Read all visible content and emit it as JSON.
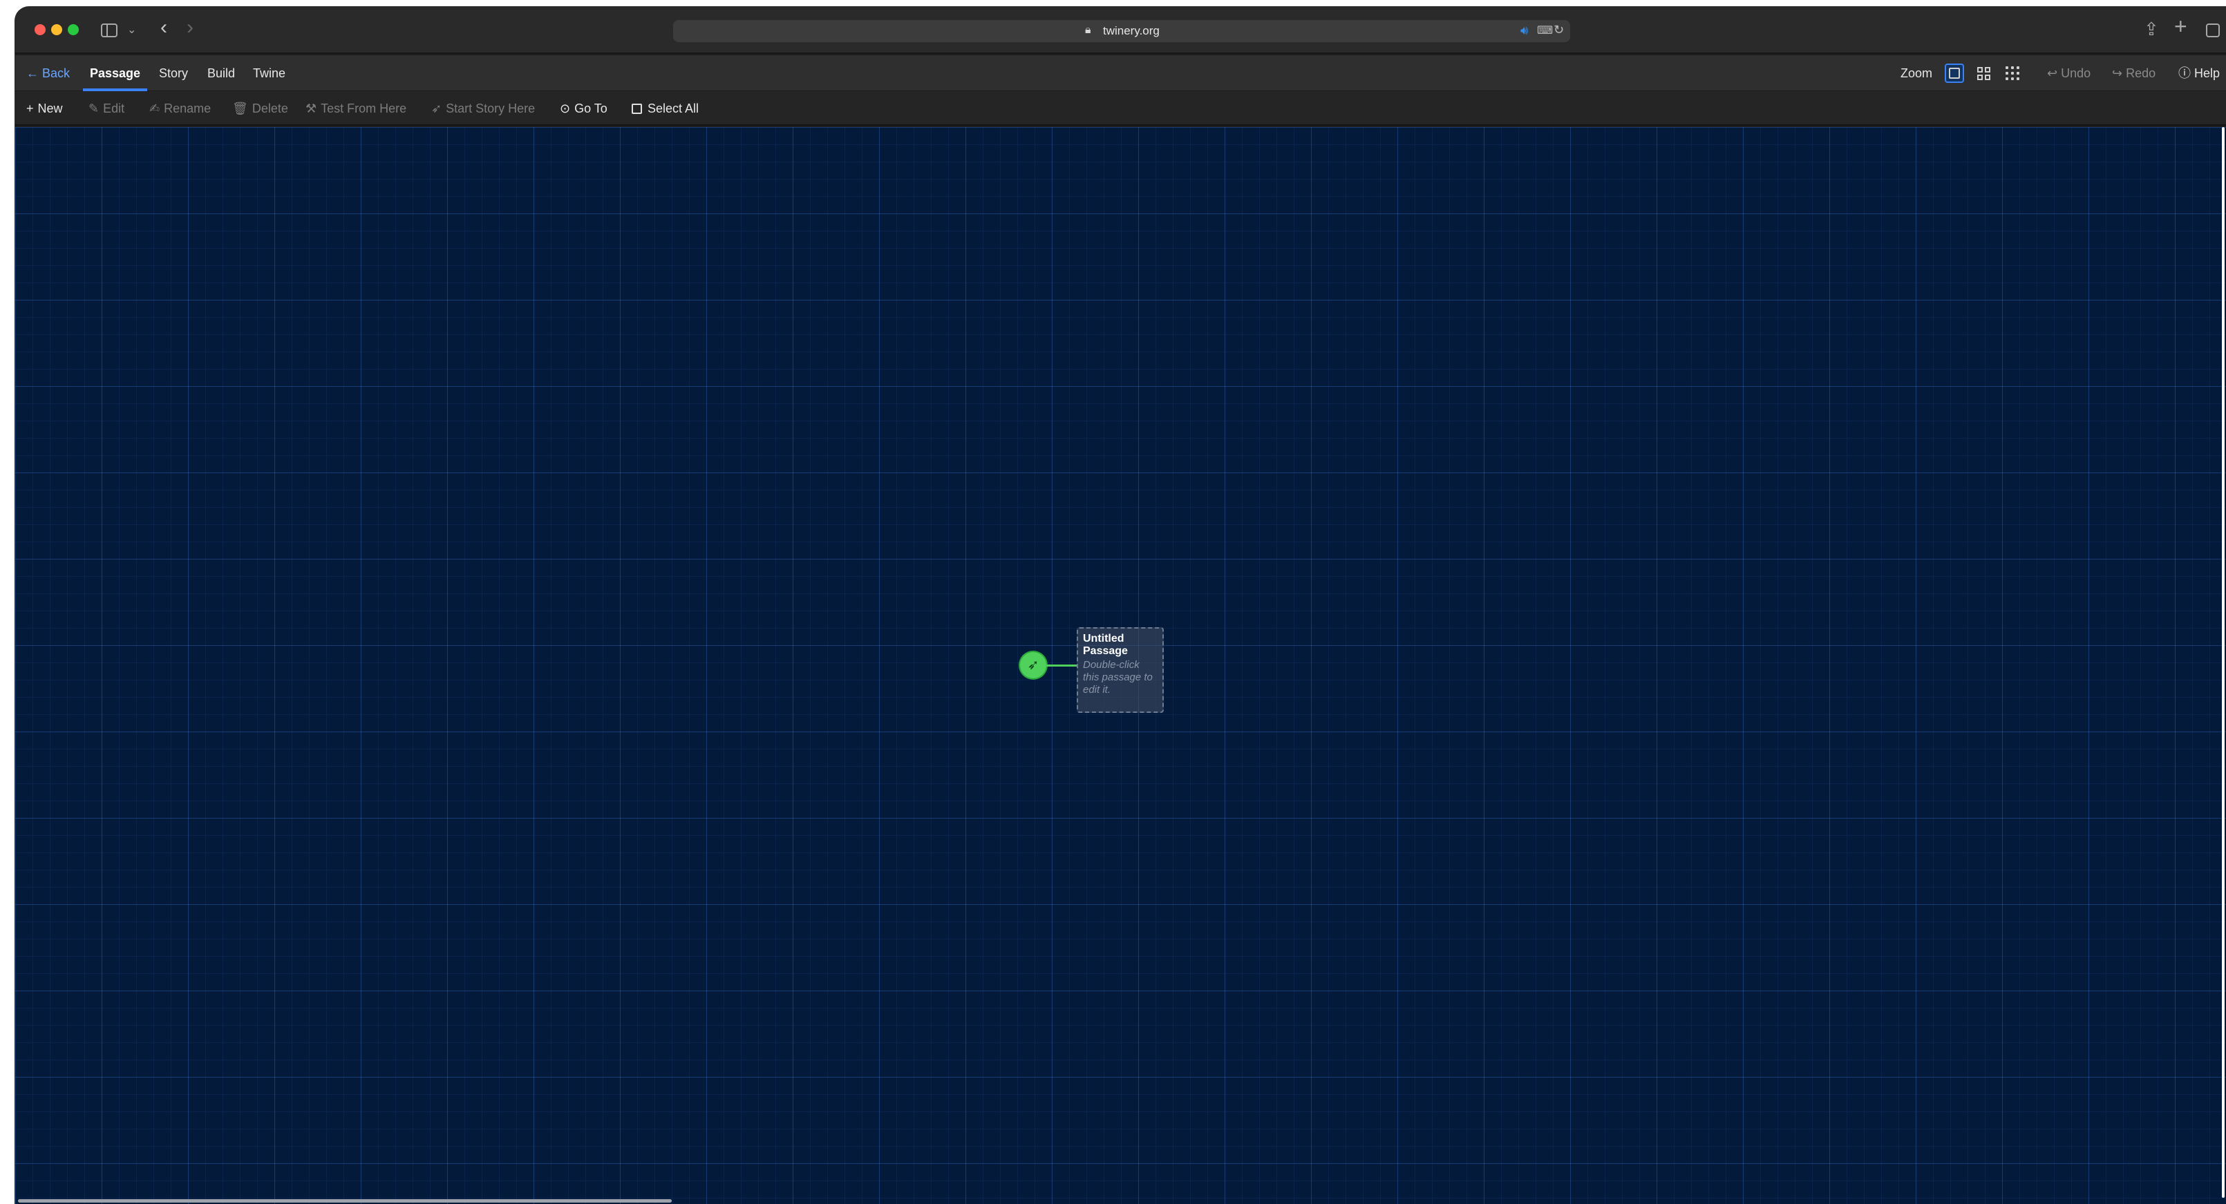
{
  "browser": {
    "url": "twinery.org"
  },
  "topbar": {
    "back_label": "Back",
    "tabs": [
      {
        "label": "Passage"
      },
      {
        "label": "Story"
      },
      {
        "label": "Build"
      },
      {
        "label": "Twine"
      }
    ],
    "zoom_label": "Zoom",
    "undo_label": "Undo",
    "redo_label": "Redo",
    "help_label": "Help"
  },
  "toolbar": {
    "new_label": "New",
    "edit_label": "Edit",
    "rename_label": "Rename",
    "delete_label": "Delete",
    "test_from_here_label": "Test From Here",
    "start_story_here_label": "Start Story Here",
    "go_to_label": "Go To",
    "select_all_label": "Select All"
  },
  "story_map": {
    "passage": {
      "title": "Untitled Passage",
      "excerpt": "Double-click this passage to edit it."
    },
    "start_badge_icon": "rocket-icon"
  },
  "colors": {
    "canvas_background": "#031a3a",
    "accent": "#3b82f6",
    "start_green": "#4fd15c"
  }
}
